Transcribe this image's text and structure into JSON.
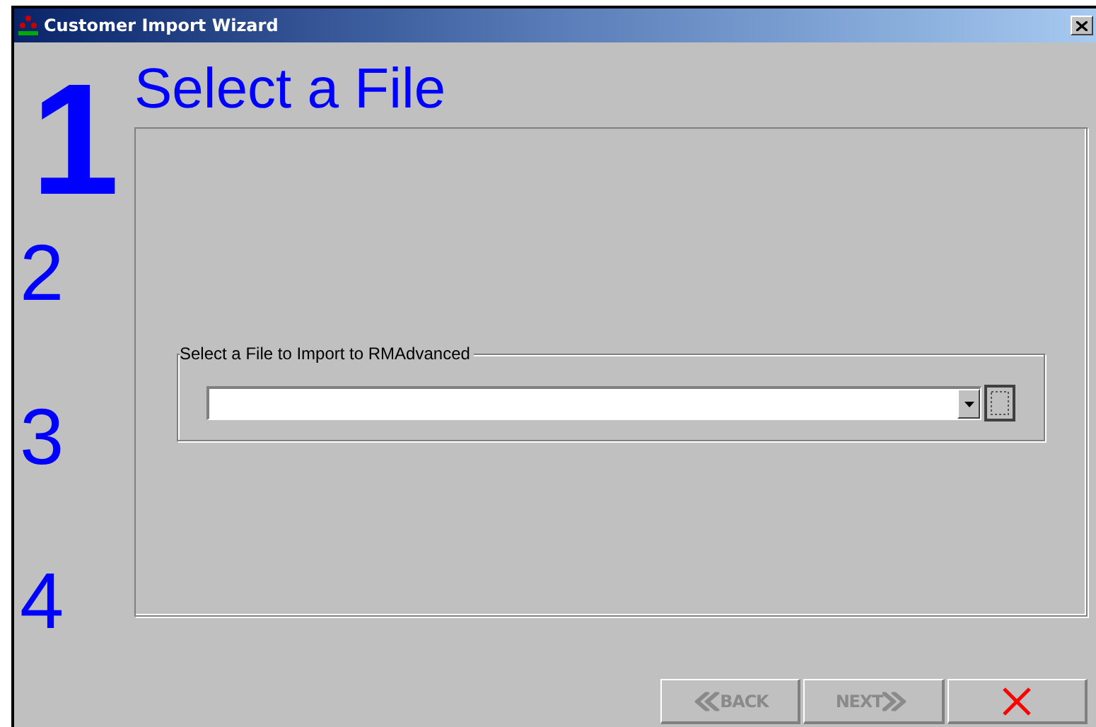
{
  "window": {
    "title": "Customer Import Wizard"
  },
  "steps": [
    {
      "label": "1",
      "selected": true
    },
    {
      "label": "2",
      "selected": false
    },
    {
      "label": "3",
      "selected": false
    },
    {
      "label": "4",
      "selected": false
    }
  ],
  "page_title": "Select a File",
  "file_group": {
    "legend": "Select a File to Import to RMAdvanced"
  },
  "buttons": [
    {
      "kind": "back",
      "label": "BACK",
      "disabled": true
    },
    {
      "kind": "next",
      "label": "NEXT",
      "disabled": true
    },
    {
      "kind": "cancel",
      "disabled": false
    }
  ]
}
